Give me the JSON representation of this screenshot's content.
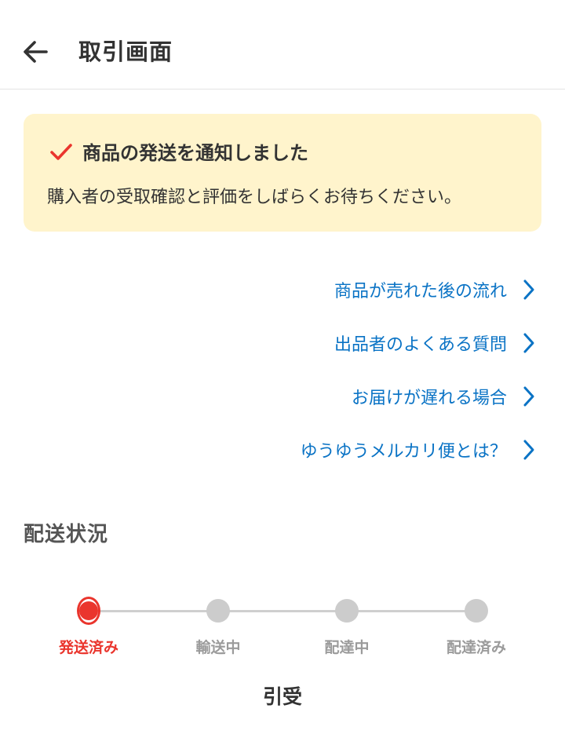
{
  "header": {
    "title": "取引画面",
    "back_icon": "arrow-left-icon"
  },
  "notice": {
    "icon": "check-icon",
    "icon_color": "#ea352d",
    "title": "商品の発送を通知しました",
    "body": "購入者の受取確認と評価をしばらくお待ちください。",
    "background": "#fff4cc"
  },
  "links": [
    {
      "label": "商品が売れた後の流れ",
      "icon": "chevron-right-icon"
    },
    {
      "label": "出品者のよくある質問",
      "icon": "chevron-right-icon"
    },
    {
      "label": "お届けが遅れる場合",
      "icon": "chevron-right-icon"
    },
    {
      "label": "ゆうゆうメルカリ便とは？",
      "icon": "chevron-right-icon"
    }
  ],
  "link_color": "#0a73c5",
  "delivery": {
    "section_title": "配送状況",
    "steps": [
      {
        "label": "発送済み",
        "active": true
      },
      {
        "label": "輸送中",
        "active": false
      },
      {
        "label": "配達中",
        "active": false
      },
      {
        "label": "配達済み",
        "active": false
      }
    ],
    "active_color": "#ea352d"
  },
  "bottom": {
    "label": "引受"
  }
}
